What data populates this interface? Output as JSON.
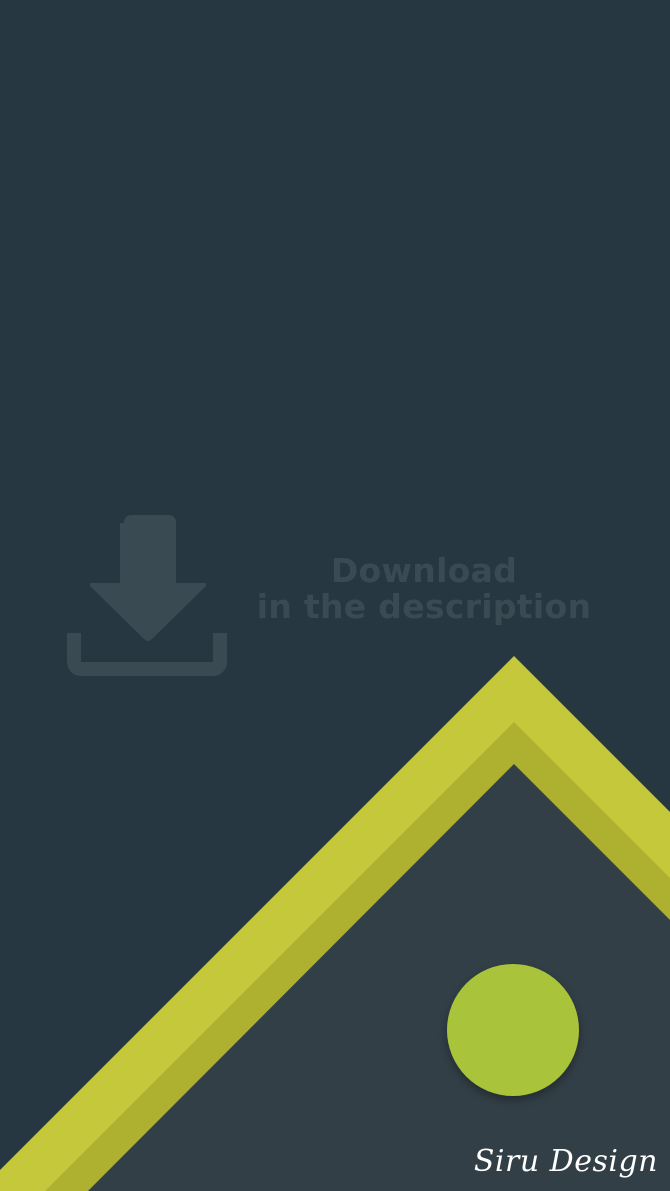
{
  "watermark": {
    "line1": "Download",
    "line2": "in the description",
    "icon": "download-icon"
  },
  "signature": {
    "text": "Siru Design"
  },
  "colors": {
    "background": "#263741",
    "stripe_light": "#c4c83a",
    "stripe_dark": "#aeb02f",
    "inner_panel": "#333f47",
    "circle": "#a9c33b",
    "watermark": "#3a4a53"
  }
}
